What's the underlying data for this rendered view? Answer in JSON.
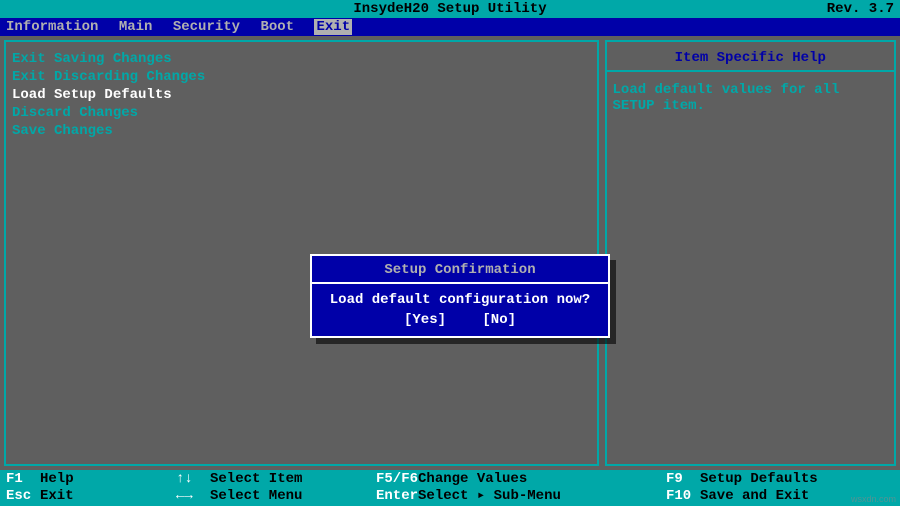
{
  "title": "InsydeH20 Setup Utility",
  "rev": "Rev. 3.7",
  "tabs": {
    "t0": "Information",
    "t1": "Main",
    "t2": "Security",
    "t3": "Boot",
    "t4": "Exit"
  },
  "exit_menu": {
    "i0": "Exit Saving Changes",
    "i1": "Exit Discarding Changes",
    "i2": "Load Setup Defaults",
    "i3": "Discard Changes",
    "i4": "Save Changes"
  },
  "help": {
    "title": "Item Specific Help",
    "body_l1": "Load default values for all",
    "body_l2": "SETUP item."
  },
  "dialog": {
    "title": "Setup Confirmation",
    "message": "Load default configuration now?",
    "yes": "[Yes]",
    "no": "[No]"
  },
  "footer": {
    "r1": {
      "k1": "F1",
      "l1": "Help",
      "s2": "↑↓",
      "l2": "Select Item",
      "k3": "F5/F6",
      "l3": "Change Values",
      "k4": "F9",
      "l4": "Setup Defaults"
    },
    "r2": {
      "k1": "Esc",
      "l1": "Exit",
      "s2": "←→",
      "l2": "Select Menu",
      "k3": "Enter",
      "l3": "Select ▸ Sub-Menu",
      "k4": "F10",
      "l4": "Save and Exit"
    }
  },
  "watermark": "wsxdn.com"
}
